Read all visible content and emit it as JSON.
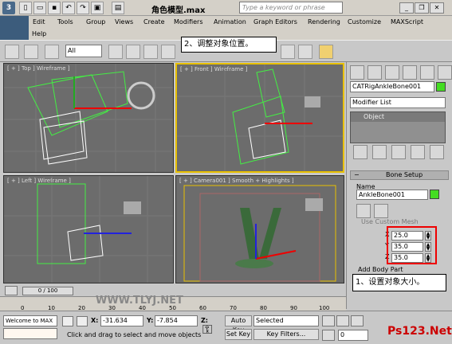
{
  "titlebar": {
    "doc_title": "角色模型.max",
    "search_placeholder": "Type a keyword or phrase"
  },
  "menu": {
    "row1": [
      "Edit",
      "Tools",
      "Group",
      "Views",
      "Create",
      "Modifiers",
      "Animation",
      "Graph Editors",
      "Rendering",
      "Customize",
      "MAXScript"
    ],
    "row2": [
      "Help"
    ]
  },
  "toolbar": {
    "filter_value": "All",
    "callout": "2、调整对象位置。"
  },
  "viewports": {
    "top": "[ + ] Top ] Wireframe ]",
    "front": "[ + ] Front ] Wireframe ]",
    "left": "[ + ] Left ] Wireframe ]",
    "camera": "[ + ] Camera001 ] Smooth + Highlights ]"
  },
  "command_panel": {
    "object_name": "CATRigAnkleBone001",
    "modifier_list": "Modifier List",
    "stack_item": "Object",
    "rollout": "Bone Setup",
    "name_label": "Name",
    "bone_name": "AnkleBone001",
    "custom_mesh": "Use Custom Mesh",
    "spinners": [
      {
        "axis": "X",
        "value": "25.0"
      },
      {
        "axis": "Y",
        "value": "35.0"
      },
      {
        "axis": "Z",
        "value": "35.0"
      }
    ],
    "add_body_part": "Add Body Part",
    "callout": "1、设置对象大小。"
  },
  "timeline": {
    "frame_counter": "0 / 100",
    "ticks": [
      "0",
      "10",
      "20",
      "30",
      "40",
      "50",
      "60",
      "70",
      "80",
      "90",
      "100"
    ]
  },
  "status": {
    "maxscript_text": "Welcome to MAX",
    "prompt": "Click and drag to select and move objects",
    "x_label": "X:",
    "x_value": "-31.634",
    "y_label": "Y:",
    "y_value": "-7.854",
    "z_label": "Z:",
    "auto_key": "Auto Key",
    "set_key": "Set Key",
    "selected": "Selected",
    "key_filters": "Key Filters...",
    "frame": "0"
  },
  "watermark": {
    "site": "Ps123.Net",
    "url_text": "WWW.TLYJ.NET"
  }
}
